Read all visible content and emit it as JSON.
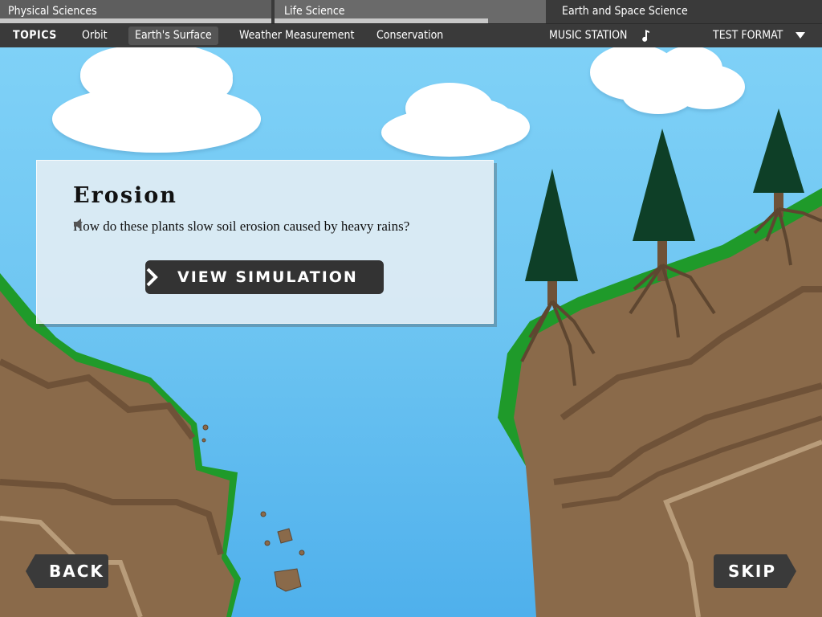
{
  "categories": [
    {
      "label": "Physical Sciences",
      "bar_color": "#c8c8c8"
    },
    {
      "label": "Life Science",
      "bar_color": "#c8c8c8"
    },
    {
      "label": "Earth and Space Science",
      "bar_color": "#6fc6f2"
    }
  ],
  "nav": {
    "topics_label": "TOPICS",
    "items": [
      {
        "label": "Orbit"
      },
      {
        "label": "Earth's Surface",
        "active": true
      },
      {
        "label": "Weather Measurement"
      },
      {
        "label": "Conservation"
      }
    ],
    "music_station_label": "MUSIC STATION",
    "test_format_label": "TEST FORMAT"
  },
  "card": {
    "title": "Erosion",
    "question": "How do these plants slow soil erosion caused by heavy rains?",
    "button_label": "VIEW SIMULATION"
  },
  "footer": {
    "back_label": "BACK",
    "skip_label": "SKIP"
  },
  "colors": {
    "sky": "#6fc6f2",
    "ground": "#8a6a4a",
    "grass": "#1f9a2a",
    "tree": "#0e3f27",
    "ui_dark": "#3a3a3a"
  },
  "icons": [
    "music-note-icon",
    "chevron-down-icon",
    "speaker-icon",
    "chevron-right-icon",
    "back-arrow-icon",
    "skip-arrow-icon"
  ]
}
